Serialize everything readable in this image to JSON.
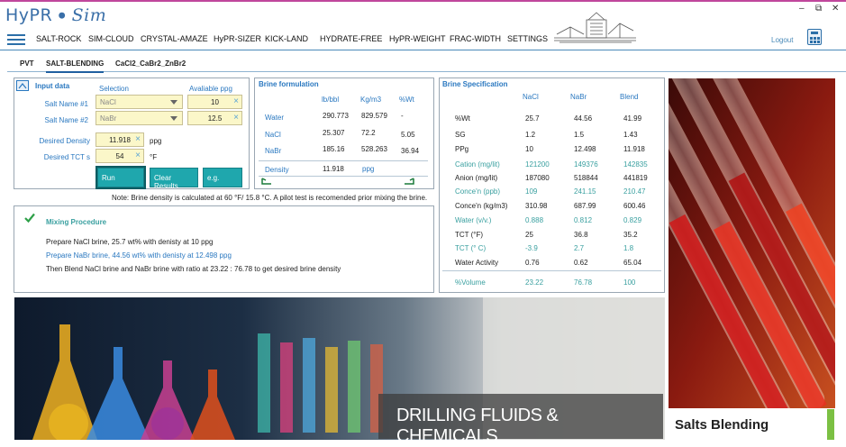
{
  "app": {
    "logo_main": "HyPR",
    "logo_sub": "Sim",
    "minimize": "–",
    "restore": "⧉",
    "close": "✕"
  },
  "menu": [
    "SALT-ROCK",
    "SIM-CLOUD",
    "CRYSTAL-AMAZE",
    "HyPR-SIZER",
    "KICK-LAND",
    "HYDRATE-FREE",
    "HyPR-WEIGHT",
    "FRAC-WIDTH",
    "SETTINGS"
  ],
  "logout": "Logout",
  "tabs": [
    "PVT",
    "SALT-BLENDING",
    "CaCl2_CaBr2_ZnBr2"
  ],
  "input": {
    "title": "Input data",
    "selection_hdr": "Selection",
    "available_hdr": "Avaliable ppg",
    "salt1_label": "Salt Name #1",
    "salt1_value": "NaCl",
    "salt1_ppg": "10",
    "salt2_label": "Salt Name #2",
    "salt2_value": "NaBr",
    "salt2_ppg": "12.5",
    "density_label": "Desired Density",
    "density_value": "11.918",
    "density_unit": "ppg",
    "tct_label": "Desired TCT s",
    "tct_value": "54",
    "tct_unit": "°F",
    "run": "Run",
    "clear": "Clear Results",
    "eg": "e.g."
  },
  "formulation": {
    "title": "Brine formulation",
    "headers": [
      "lb/bbl",
      "Kg/m3",
      "%Wt"
    ],
    "rows": [
      {
        "label": "Water",
        "v": [
          "290.773",
          "829.579",
          "-"
        ]
      },
      {
        "label": "NaCl",
        "v": [
          "25.307",
          "72.2",
          "5.05"
        ]
      },
      {
        "label": "NaBr",
        "v": [
          "185.16",
          "528.263",
          "36.94"
        ]
      }
    ],
    "density_label": "Density",
    "density_value": "11.918",
    "density_unit": "ppg"
  },
  "spec": {
    "title": "Brine Specification",
    "headers": [
      "NaCl",
      "NaBr",
      "Blend"
    ],
    "rows": [
      {
        "label": "%Wt",
        "v": [
          "25.7",
          "44.56",
          "41.99"
        ],
        "style": "dark"
      },
      {
        "label": "SG",
        "v": [
          "1.2",
          "1.5",
          "1.43"
        ],
        "style": "blue"
      },
      {
        "label": "PPg",
        "v": [
          "10",
          "12.498",
          "11.918"
        ],
        "style": "dark"
      },
      {
        "label": "Cation (mg/lit)",
        "v": [
          "121200",
          "149376",
          "142835"
        ],
        "style": "green"
      },
      {
        "label": "Anion (mg/lit)",
        "v": [
          "187080",
          "518844",
          "441819"
        ],
        "style": "dark"
      },
      {
        "label": "Conce'n (ppb)",
        "v": [
          "109",
          "241.15",
          "210.47"
        ],
        "style": "green"
      },
      {
        "label": "Conce'n (kg/m3)",
        "v": [
          "310.98",
          "687.99",
          "600.46"
        ],
        "style": "dark"
      },
      {
        "label": "Water (v/v.)",
        "v": [
          "0.888",
          "0.812",
          "0.829"
        ],
        "style": "green"
      },
      {
        "label": "TCT (°F)",
        "v": [
          "25",
          "36.8",
          "35.2"
        ],
        "style": "dark"
      },
      {
        "label": "TCT (° C)",
        "v": [
          "-3.9",
          "2.7",
          "1.8"
        ],
        "style": "green"
      },
      {
        "label": "Water Activity",
        "v": [
          "0.76",
          "0.62",
          "65.04"
        ],
        "style": "dark"
      },
      {
        "label": "%Volume",
        "v": [
          "23.22",
          "76.78",
          "100"
        ],
        "style": "green"
      }
    ]
  },
  "note": "Note: Brine density is calculated at 60 °F/ 15.8 °C. A pilot test is recomended prior mixing the brine.",
  "mixing": {
    "title": "Mixing Procedure",
    "lines": [
      "Prepare NaCl brine, 25.7 wt% with denisty at 10 ppg",
      "Prepare NaBr brine, 44.56 wt% with denisty at 12.498 ppg",
      "Then Blend NaCl brine and NaBr brine with ratio at 23.22 : 76.78 to get desired brine density"
    ]
  },
  "banner_text": "DRILLING FLUIDS & CHEMICALS",
  "side_caption": "Salts Blending"
}
